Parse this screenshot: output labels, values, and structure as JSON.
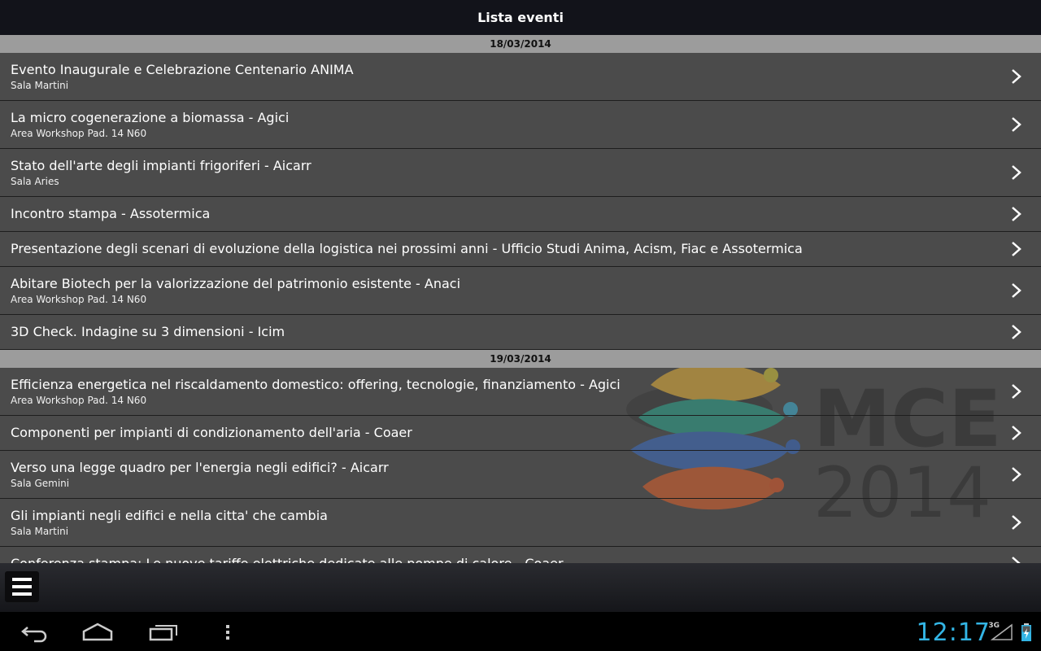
{
  "app": {
    "title": "Lista eventi"
  },
  "sections": [
    {
      "date": "18/03/2014",
      "events": [
        {
          "title": "Evento Inaugurale e Celebrazione Centenario ANIMA",
          "location": "Sala Martini"
        },
        {
          "title": "La micro cogenerazione a biomassa - Agici",
          "location": "Area Workshop Pad. 14 N60"
        },
        {
          "title": "Stato dell'arte degli impianti frigoriferi - Aicarr",
          "location": "Sala Aries"
        },
        {
          "title": "Incontro stampa - Assotermica",
          "location": ""
        },
        {
          "title": "Presentazione degli scenari di evoluzione della logistica nei prossimi anni - Ufficio Studi Anima, Acism, Fiac e Assotermica",
          "location": ""
        },
        {
          "title": "Abitare Biotech per la valorizzazione del patrimonio esistente - Anaci",
          "location": "Area Workshop Pad. 14 N60"
        },
        {
          "title": "3D Check. Indagine su 3 dimensioni - Icim",
          "location": ""
        }
      ]
    },
    {
      "date": "19/03/2014",
      "events": [
        {
          "title": "Efficienza energetica nel riscaldamento domestico: offering, tecnologie, finanziamento - Agici",
          "location": "Area Workshop Pad. 14 N60"
        },
        {
          "title": "Componenti per impianti di condizionamento dell'aria - Coaer",
          "location": ""
        },
        {
          "title": "Verso una legge quadro per l'energia negli edifici? - Aicarr",
          "location": "Sala Gemini"
        },
        {
          "title": "Gli impianti negli edifici e nella citta' che cambia",
          "location": "Sala Martini"
        },
        {
          "title": "Conferenza stampa: Le nuove tariffe elettriche dedicate alle pompe di calore - Coaer",
          "location": ""
        }
      ]
    }
  ],
  "background_logo": {
    "line1": "MCE",
    "line2": "2014"
  },
  "bottom_bar": {
    "menu_icon": "hamburger-menu-icon"
  },
  "nav_bar": {
    "back_icon": "back-icon",
    "home_icon": "home-icon",
    "recents_icon": "recent-apps-icon",
    "overflow_icon": "overflow-menu-icon"
  },
  "status": {
    "time": "12:17",
    "network": "3G",
    "accent": "#33b5e5"
  }
}
